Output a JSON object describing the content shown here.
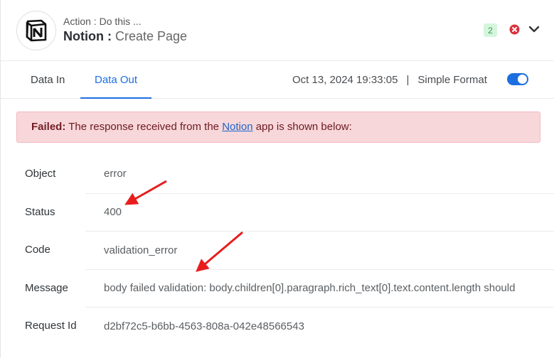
{
  "header": {
    "action_label": "Action : Do this ...",
    "app_name": "Notion :",
    "action_name": " Create Page",
    "step_count": "2",
    "logo_icon": "notion-logo",
    "status_icon": "error-x-icon",
    "expand_icon": "chevron-down-icon"
  },
  "tabs": [
    {
      "label": "Data In",
      "active": false
    },
    {
      "label": "Data Out",
      "active": true
    }
  ],
  "meta": {
    "timestamp": "Oct 13, 2024 19:33:05",
    "separator": "|",
    "format_label": "Simple Format",
    "simple_format_enabled": true
  },
  "alert": {
    "prefix": "Failed:",
    "text_before": " The response received from the ",
    "link": "Notion",
    "text_after": " app is shown below:"
  },
  "rows": [
    {
      "label": "Object",
      "value": "error"
    },
    {
      "label": "Status",
      "value": "400"
    },
    {
      "label": "Code",
      "value": "validation_error"
    },
    {
      "label": "Message",
      "value": "body failed validation: body.children[0].paragraph.rich_text[0].text.content.length should"
    },
    {
      "label": "Request Id",
      "value": "d2bf72c5-b6bb-4563-808a-042e48566543"
    }
  ],
  "colors": {
    "accent": "#1d6fe0",
    "alert_bg": "#f8d7da",
    "error": "#d9343e",
    "annotation_arrow": "#e81c1c",
    "badge_bg": "#d5f5dd"
  }
}
